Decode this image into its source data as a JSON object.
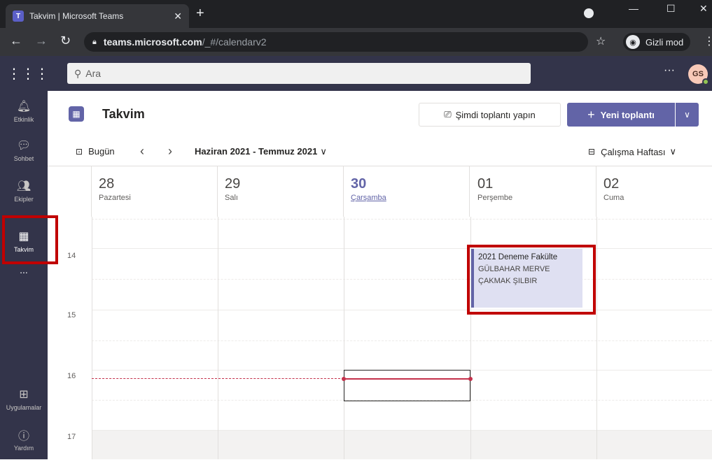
{
  "browser": {
    "tab_title": "Takvim | Microsoft Teams",
    "url_host": "teams.microsoft.com",
    "url_path": "/_#/calendarv2",
    "incognito_label": "Gizli mod"
  },
  "teams": {
    "search_placeholder": "Ara",
    "avatar_initials": "GS"
  },
  "rail": {
    "items": [
      {
        "label": "Etkinlik",
        "icon": "bell-icon"
      },
      {
        "label": "Sohbet",
        "icon": "chat-icon"
      },
      {
        "label": "Ekipler",
        "icon": "teams-icon"
      },
      {
        "label": "Takvim",
        "icon": "calendar-icon",
        "active": true
      },
      {
        "label": "Uygulamalar",
        "icon": "apps-icon"
      },
      {
        "label": "Yardım",
        "icon": "help-icon"
      }
    ],
    "more": "..."
  },
  "calendar": {
    "title": "Takvim",
    "meet_now": "Şimdi toplantı yapın",
    "new_meeting": "Yeni toplantı",
    "today": "Bugün",
    "range": "Haziran 2021 - Temmuz 2021",
    "view": "Çalışma Haftası",
    "days": [
      {
        "num": "28",
        "name": "Pazartesi"
      },
      {
        "num": "29",
        "name": "Salı"
      },
      {
        "num": "30",
        "name": "Çarşamba",
        "today": true
      },
      {
        "num": "01",
        "name": "Perşembe"
      },
      {
        "num": "02",
        "name": "Cuma"
      }
    ],
    "hours": [
      "14",
      "15",
      "16",
      "17"
    ],
    "event": {
      "title": "2021 Deneme Fakülte",
      "organizer_line1": "GÜLBAHAR MERVE",
      "organizer_line2": "ÇAKMAK ŞILBIR"
    }
  },
  "colors": {
    "accent": "#6264a7",
    "rail": "#33344a",
    "highlight_box": "#c00000",
    "now_line": "#c4314b"
  }
}
